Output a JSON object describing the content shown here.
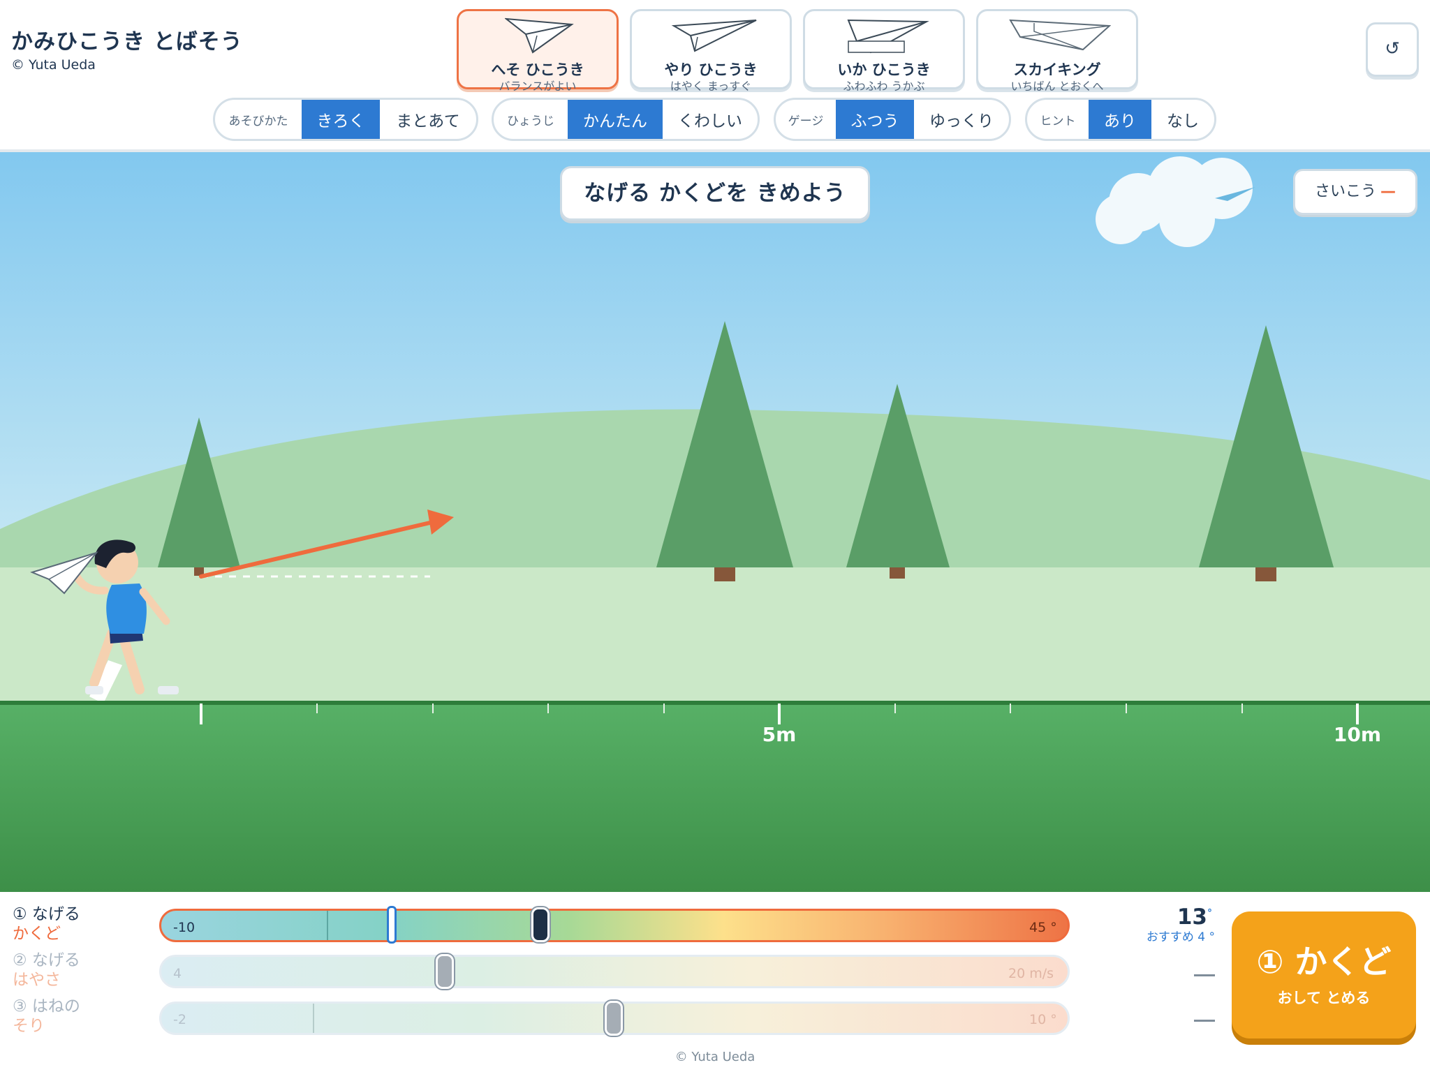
{
  "app": {
    "title": "かみひこうき とばそう",
    "credit": "© Yuta Ueda"
  },
  "planes": [
    {
      "name": "へそ ひこうき",
      "desc": "バランスがよい",
      "selected": true
    },
    {
      "name": "やり ひこうき",
      "desc": "はやく まっすぐ",
      "selected": false
    },
    {
      "name": "いか ひこうき",
      "desc": "ふわふわ うかぶ",
      "selected": false
    },
    {
      "name": "スカイキング",
      "desc": "いちばん とおくへ",
      "selected": false
    }
  ],
  "reset": {
    "icon": "reset-icon",
    "glyph": "↺"
  },
  "settings": {
    "mode": {
      "label": "あそびかた",
      "options": [
        "きろく",
        "まとあて"
      ],
      "selected": 0
    },
    "display": {
      "label": "ひょうじ",
      "options": [
        "かんたん",
        "くわしい"
      ],
      "selected": 0
    },
    "gauge": {
      "label": "ゲージ",
      "options": [
        "ふつう",
        "ゆっくり"
      ],
      "selected": 0
    },
    "hint": {
      "label": "ヒント",
      "options": [
        "あり",
        "なし"
      ],
      "selected": 0
    }
  },
  "scene": {
    "prompt": "なげる かくどを きめよう",
    "best_label": "さいこう",
    "best_value": "—",
    "distance_labels": [
      "5m",
      "10m"
    ]
  },
  "controls": {
    "angle": {
      "num": "① なげる",
      "name": "かくど",
      "min": "-10",
      "max": "45 °",
      "value": "13",
      "unit": "°",
      "recommended": "おすすめ 4 °",
      "current_fraction": 0.42,
      "hint_fraction": 0.25
    },
    "speed": {
      "num": "② なげる",
      "name": "はやさ",
      "min": "4",
      "max": "20 m/s",
      "value": "—",
      "current_fraction": 0.32
    },
    "bend": {
      "num": "③ はねの",
      "name": "そり",
      "min": "-2",
      "max": "10 °",
      "value": "—",
      "current_fraction": 0.51
    }
  },
  "action": {
    "title": "① かくど",
    "subtitle": "おして とめる"
  },
  "footer": {
    "credit": "© Yuta Ueda"
  },
  "colors": {
    "accent": "#ef6b3d",
    "selected_blue": "#2d7ad2",
    "action": "#f4a21a",
    "sky": "#8fcdee",
    "grass": "#4aa65a"
  }
}
